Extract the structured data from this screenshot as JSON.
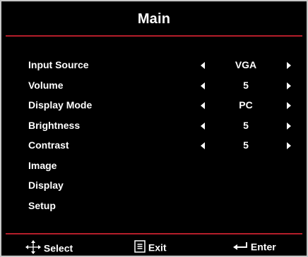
{
  "title": "Main",
  "items": [
    {
      "label": "Input Source",
      "value": "VGA"
    },
    {
      "label": "Volume",
      "value": "5"
    },
    {
      "label": "Display Mode",
      "value": "PC"
    },
    {
      "label": "Brightness",
      "value": "5"
    },
    {
      "label": "Contrast",
      "value": "5"
    },
    {
      "label": "Image"
    },
    {
      "label": "Display"
    },
    {
      "label": "Setup"
    }
  ],
  "footer": {
    "select_label": "Select",
    "exit_label": "Exit",
    "enter_label": "Enter",
    "select_icon": "four-way-arrows-icon",
    "exit_icon": "menu-icon",
    "enter_icon": "enter-arrow-icon"
  },
  "colors": {
    "background": "#000000",
    "text": "#ffffff",
    "accent_rule": "#b51e2a",
    "border": "#c7c7c7"
  }
}
